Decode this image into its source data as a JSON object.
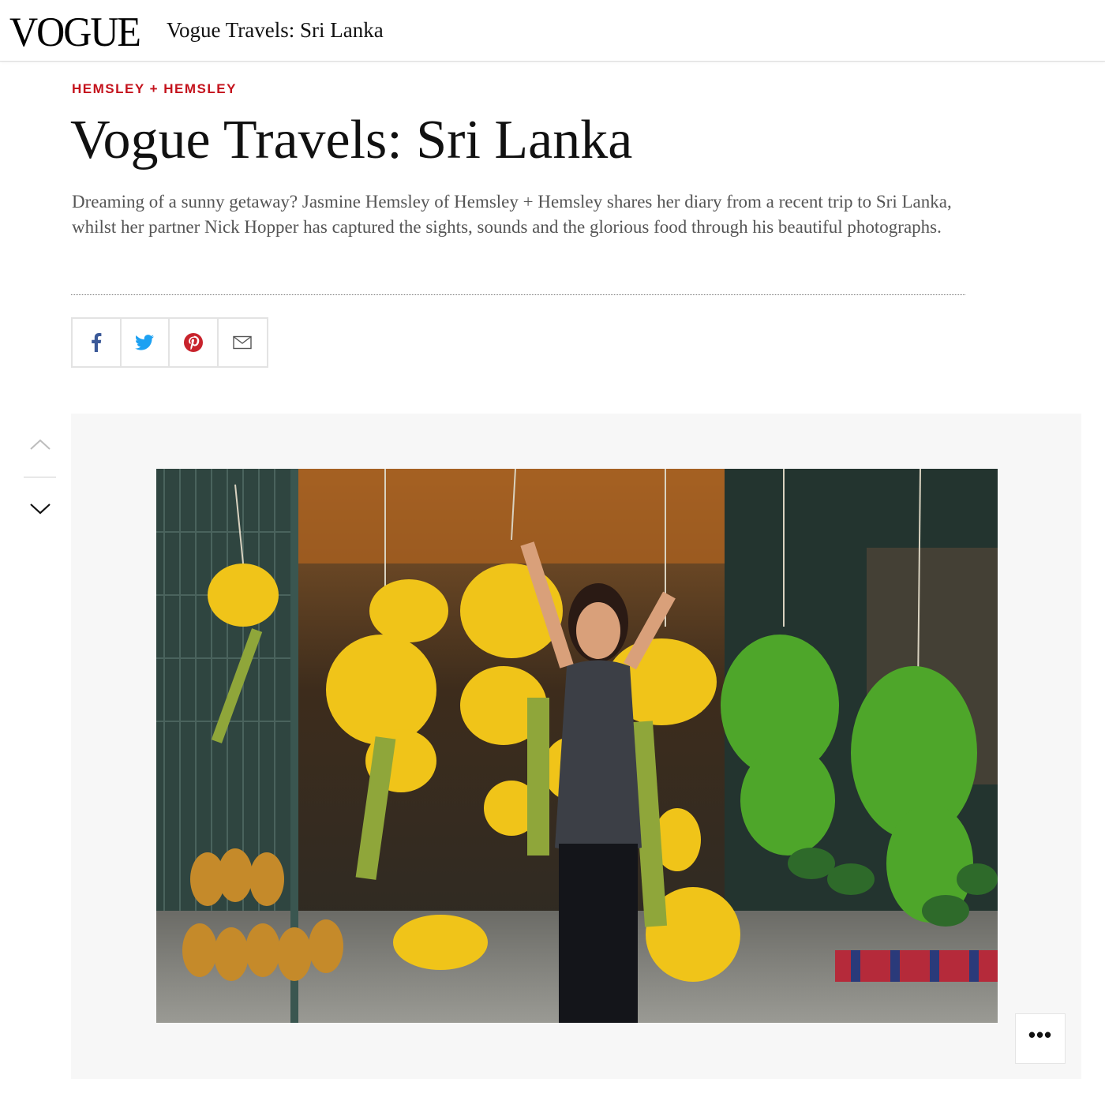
{
  "header": {
    "logo": "VOGUE",
    "title": "Vogue Travels: Sri Lanka"
  },
  "article": {
    "kicker": "HEMSLEY + HEMSLEY",
    "headline": "Vogue Travels: Sri Lanka",
    "dek": "Dreaming of a sunny getaway? Jasmine Hemsley of Hemsley + Hemsley shares her diary from a recent trip to Sri Lanka, whilst her partner Nick Hopper has captured the sights, sounds and the glorious food through his beautiful photographs."
  },
  "share": {
    "buttons": [
      {
        "icon": "facebook-icon",
        "color": "#3b5998"
      },
      {
        "icon": "twitter-icon",
        "color": "#1da1f2"
      },
      {
        "icon": "pinterest-icon",
        "color": "#c8232c"
      },
      {
        "icon": "email-icon",
        "color": "#555555"
      }
    ]
  },
  "gallery": {
    "nav_up_icon": "chevron-up-icon",
    "nav_down_icon": "chevron-down-icon",
    "more_label": "•••",
    "photo_icon": "photo-image"
  },
  "colors": {
    "kicker": "#c4121c",
    "gallery_bg": "#f7f7f7"
  }
}
